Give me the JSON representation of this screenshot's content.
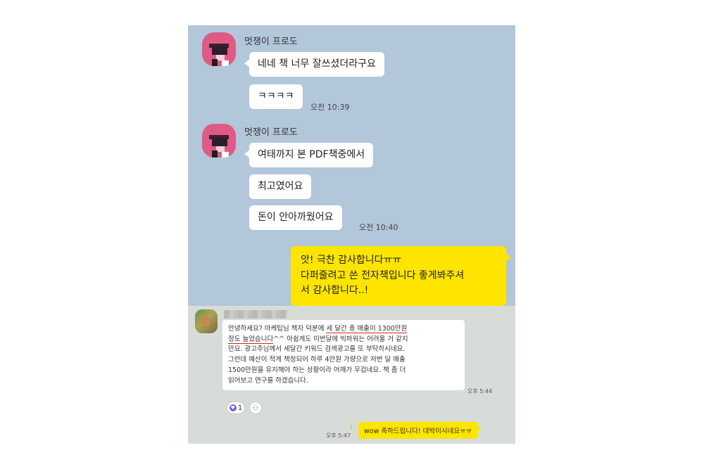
{
  "top_chat": {
    "group1": {
      "sender": "멋쟁이 프로도",
      "messages": [
        "네네 책 너무 잘쓰셨더라구요",
        "ㅋㅋㅋㅋ"
      ],
      "time": "오전 10:39"
    },
    "group2": {
      "sender": "멋쟁이 프로도",
      "messages": [
        "여태까지 본 PDF책중에서",
        "최고였어요",
        "돈이 안아까웠어요"
      ],
      "time": "오전 10:40"
    },
    "my_reply": {
      "lines": [
        "앗! 극찬 감사합니다ㅠㅠ",
        "다퍼줄려고 쓴 전자책입니다 좋게봐주셔",
        "서 감사합니다..!"
      ]
    }
  },
  "bottom_chat": {
    "message": {
      "line1_pre": "안녕하세요? 마케팁님 책자 덕분에 ",
      "line1_hl": "세 달간 총 매출이 1300만원",
      "line2_hl": "정도 늘었습니다",
      "line2_post": "^^ 아쉽게도 이번달에 빅파워는 어려울 거 같지",
      "line3": "만요. 광고주님께서 세달간 키워드 검색광고를 또 부탁하시네요.",
      "line4": "그런데 예산이 적게 책정되어 하루 4만원 가량으로 저번 달 매출",
      "line5": "1500만원을 유지해야 하는 상황이라 어깨가 무겁네요. 책 좀 더",
      "line6": "읽어보고 연구를 하겠습니다."
    },
    "message_time": "오후 5:44",
    "reaction_count": "1",
    "reply": "wow 축하드립니다! 대박이시네요ㅠㅠ",
    "reply_time": "오후 5:47",
    "unread_mark": "1",
    "colors": {
      "accent": "#fee500",
      "highlight_underline": "#dd2222",
      "top_bg": "#b2c7d9"
    }
  }
}
